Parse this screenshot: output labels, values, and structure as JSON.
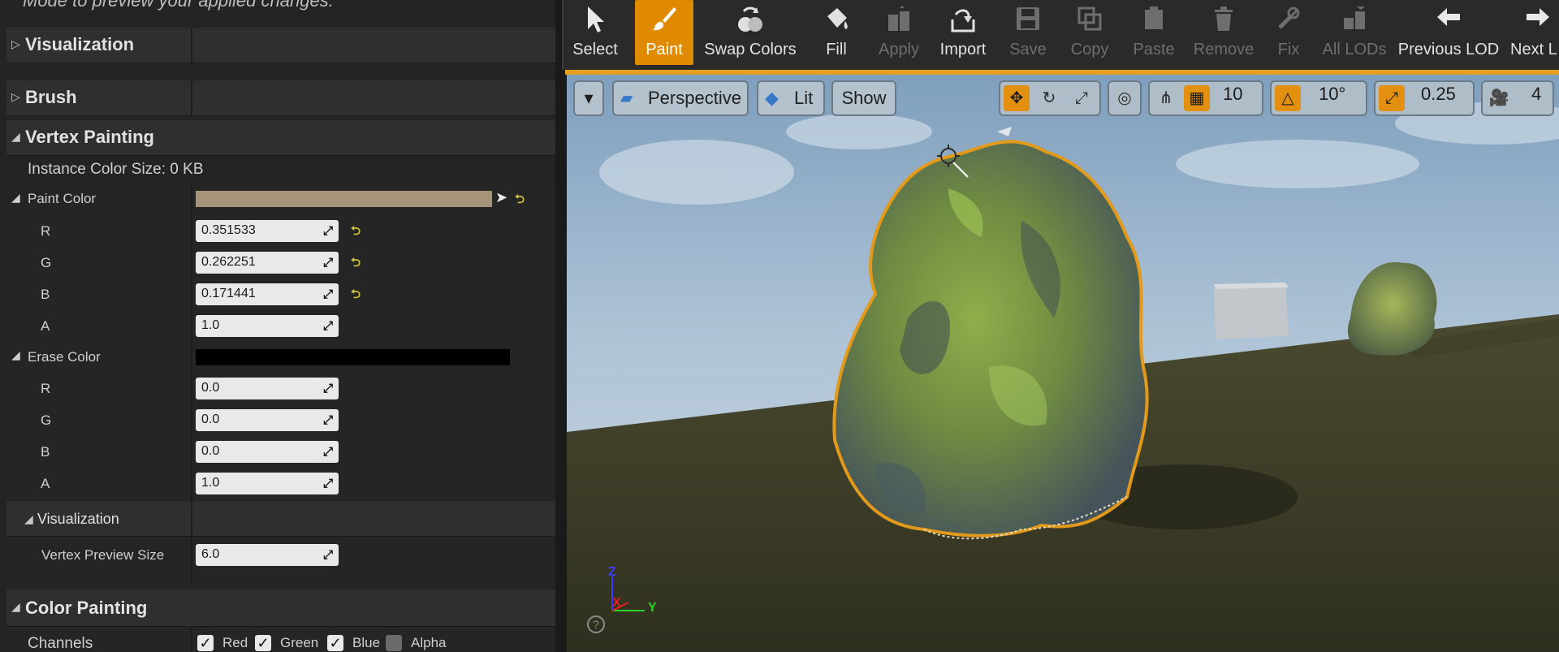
{
  "left_panel": {
    "top_note": "Mode to preview your applied changes.",
    "categories": {
      "visualization": "Visualization",
      "brush": "Brush",
      "vertex_painting": "Vertex Painting",
      "color_painting": "Color Painting"
    },
    "instance_color_size": "Instance Color Size: 0 KB",
    "paint_color": {
      "label": "Paint Color",
      "swatch_color": "#a69478",
      "r_label": "R",
      "r": "0.351533",
      "g_label": "G",
      "g": "0.262251",
      "b_label": "B",
      "b": "0.171441",
      "a_label": "A",
      "a": "1.0"
    },
    "erase_color": {
      "label": "Erase Color",
      "swatch_color": "#000000",
      "r_label": "R",
      "r": "0.0",
      "g_label": "G",
      "g": "0.0",
      "b_label": "B",
      "b": "0.0",
      "a_label": "A",
      "a": "1.0"
    },
    "sub_visualization": {
      "label": "Visualization",
      "vertex_preview_size_label": "Vertex Preview Size",
      "vertex_preview_size": "6.0"
    },
    "channels": {
      "label": "Channels",
      "red": "Red",
      "green": "Green",
      "blue": "Blue",
      "alpha": "Alpha"
    }
  },
  "toolbar": {
    "select": "Select",
    "paint": "Paint",
    "swap_colors": "Swap Colors",
    "fill": "Fill",
    "apply": "Apply",
    "import": "Import",
    "save": "Save",
    "copy": "Copy",
    "paste": "Paste",
    "remove": "Remove",
    "fix": "Fix",
    "all_lods": "All LODs",
    "previous_lod": "Previous LOD",
    "next_lod": "Next L"
  },
  "viewport": {
    "perspective": "Perspective",
    "lit": "Lit",
    "show": "Show",
    "grid_snap": "10",
    "rotation_snap": "10°",
    "scale_snap": "0.25",
    "camera_speed": "4",
    "axis_x": "X",
    "axis_y": "Y",
    "axis_z": "Z",
    "accent_color": "#e5a020"
  }
}
